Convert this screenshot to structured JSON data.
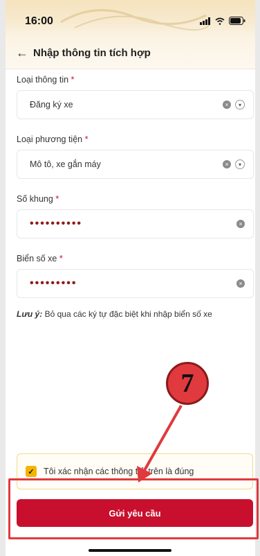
{
  "status": {
    "time": "16:00"
  },
  "header": {
    "title": "Nhập thông tin tích hợp"
  },
  "fields": [
    {
      "label": "Loại thông tin",
      "value": "Đăng ký xe"
    },
    {
      "label": "Loại phương tiện",
      "value": "Mô tô, xe gắn máy"
    },
    {
      "label": "Số khung",
      "value": "••••••••••"
    },
    {
      "label": "Biển số xe",
      "value": "•••••••••"
    }
  ],
  "required_marker": "*",
  "note": {
    "prefix": "Lưu ý:",
    "text": "Bỏ qua các ký tự đặc biệt khi nhập biển số xe"
  },
  "confirm": {
    "text": "Tôi xác nhận các thông t   ở trên là đúng",
    "checked": true
  },
  "submit_label": "Gửi yêu cầu",
  "annotation": {
    "step": "7"
  },
  "colors": {
    "primary": "#c8102e",
    "checkbox": "#f4b400",
    "annotation": "#e0393e"
  }
}
